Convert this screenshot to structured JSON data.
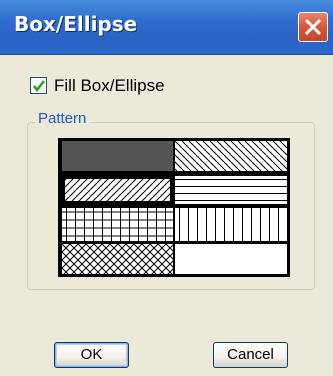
{
  "window": {
    "title": "Box/Ellipse"
  },
  "fill": {
    "label": "Fill Box/Ellipse",
    "checked": true
  },
  "pattern_group": {
    "legend": "Pattern",
    "patterns": [
      {
        "name": "solid"
      },
      {
        "name": "diagonal-backward"
      },
      {
        "name": "diagonal-forward"
      },
      {
        "name": "horizontal"
      },
      {
        "name": "grid"
      },
      {
        "name": "vertical"
      },
      {
        "name": "crosshatch-diagonal"
      },
      {
        "name": "none"
      }
    ],
    "selected": "diagonal-forward"
  },
  "buttons": {
    "ok": "OK",
    "cancel": "Cancel"
  },
  "colors": {
    "titlebar": "#2a62c4",
    "close": "#d4573a",
    "legend": "#1c5ac8",
    "face": "#ece9d8",
    "solid_fill": "#555555"
  }
}
